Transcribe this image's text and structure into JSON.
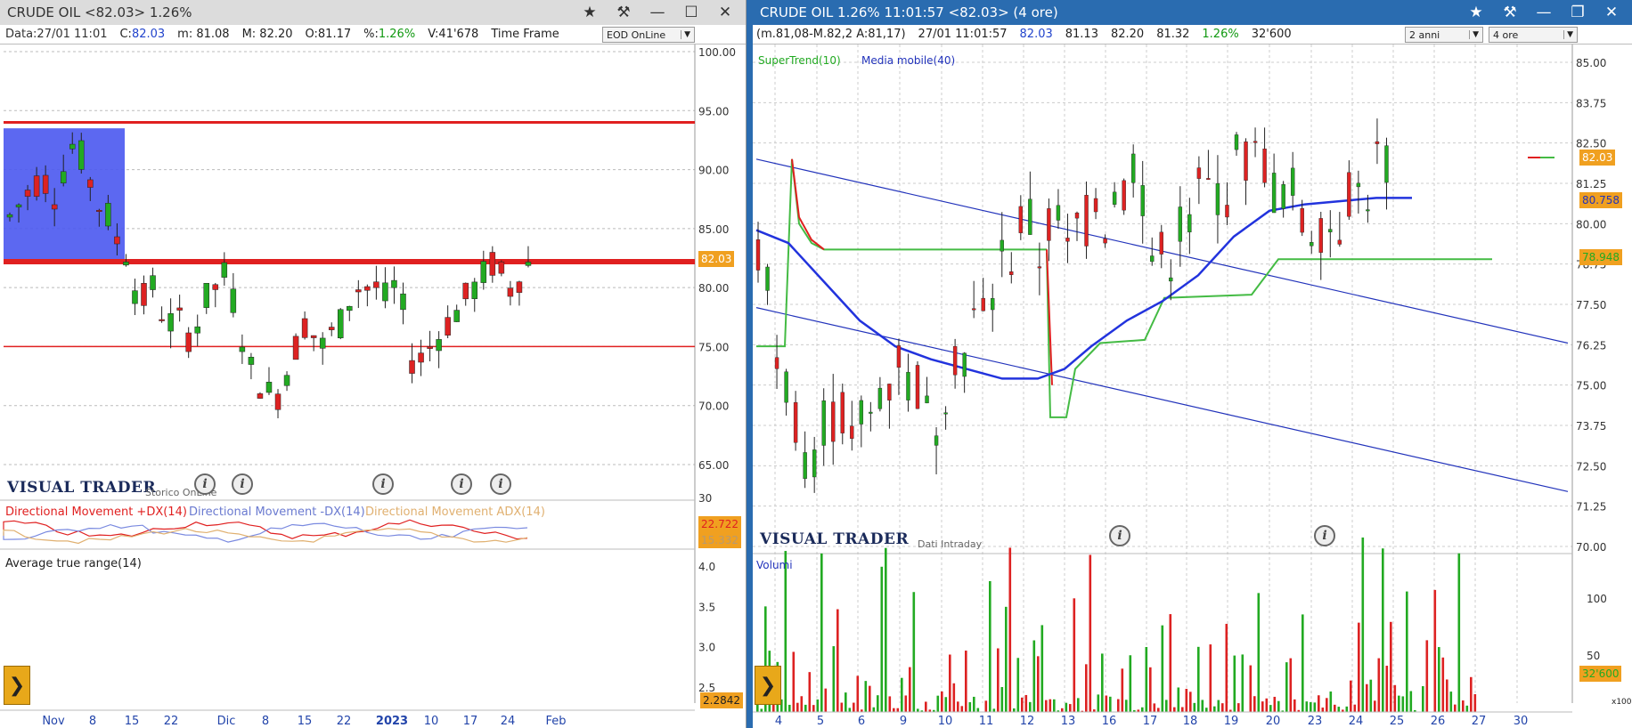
{
  "left": {
    "title": "CRUDE OIL <82.03> 1.26%",
    "info": {
      "data": "Data:27/01 11:01",
      "c_label": "C:",
      "c_value": "82.03",
      "m": "m: 81.08",
      "M": "M: 82.20",
      "O": "O:81.17",
      "pct_label": "%:",
      "pct_value": "1.26%",
      "V": "V:41'678",
      "timeframe_label": "Time Frame",
      "timeframe_value": "EOD OnLine"
    },
    "y_ticks": [
      "100.00",
      "95.00",
      "90.00",
      "85.00",
      "80.00",
      "75.00",
      "70.00",
      "65.00"
    ],
    "price_tag": "82.03",
    "brand": "VISUAL TRADER",
    "brand_sub": "Storico OnLine",
    "dm": {
      "label_pdx": "Directional Movement +DX(14)",
      "label_mdx": "Directional Movement -DX(14)",
      "label_adx": "Directional Movement ADX(14)",
      "tick": "30",
      "val1": "22.722",
      "val2": "15.332"
    },
    "atr": {
      "label": "Average true range(14)",
      "ticks": [
        "4.0",
        "3.5",
        "3.0",
        "2.5"
      ],
      "value": "2.2842"
    },
    "x_labels": [
      "Nov",
      "8",
      "15",
      "22",
      "Dic",
      "8",
      "15",
      "22",
      "2023",
      "10",
      "17",
      "24",
      "Feb"
    ]
  },
  "right": {
    "title": "CRUDE OIL 1.26% 11:01:57  <82.03> (4 ore)",
    "info": {
      "range": "(m.81,08-M.82,2 A:81,17)",
      "datetime": "27/01 11:01:57",
      "last": "82.03",
      "v1": "81.13",
      "v2": "82.20",
      "v3": "81.32",
      "pct": "1.26%",
      "vol": "32'600",
      "period": "2 anni",
      "interval": "4 ore"
    },
    "legend": {
      "supertrend": "SuperTrend(10)",
      "ma": "Media mobile(40)"
    },
    "y_ticks": [
      "85.00",
      "83.75",
      "82.50",
      "81.25",
      "80.00",
      "78.75",
      "77.50",
      "76.25",
      "75.00",
      "73.75",
      "72.50",
      "71.25",
      "70.00"
    ],
    "tags": {
      "price": "82.03",
      "ma": "80.758",
      "st": "78.948"
    },
    "brand": "VISUAL TRADER",
    "brand_sub": "Dati Intraday",
    "volume": {
      "label": "Volumi",
      "ticks": [
        "100",
        "50"
      ],
      "value": "32'600",
      "unit": "x1000"
    },
    "x_labels": [
      "4",
      "5",
      "6",
      "9",
      "10",
      "11",
      "12",
      "13",
      "16",
      "17",
      "18",
      "19",
      "20",
      "23",
      "24",
      "25",
      "26",
      "27",
      "30"
    ]
  },
  "colors": {
    "bull": "#22aa22",
    "bear": "#dd2222",
    "accent": "#2a6cb0",
    "tag_orange": "#f0a020"
  }
}
